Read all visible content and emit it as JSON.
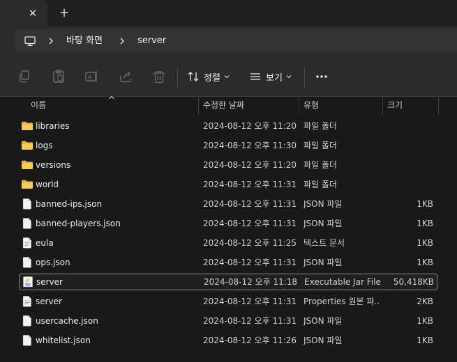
{
  "tabs": {
    "close_glyph": "✕",
    "new_glyph": "+"
  },
  "breadcrumb": {
    "items": [
      "바탕 화면",
      "server"
    ]
  },
  "toolbar": {
    "sort_label": "정렬",
    "view_label": "보기"
  },
  "columns": {
    "name": "이름",
    "date": "수정한 날짜",
    "type": "유형",
    "size": "크기"
  },
  "files": [
    {
      "name": "libraries",
      "date": "2024-08-12 오후 11:20",
      "type": "파일 폴더",
      "size": "",
      "icon": "folder-icon"
    },
    {
      "name": "logs",
      "date": "2024-08-12 오후 11:30",
      "type": "파일 폴더",
      "size": "",
      "icon": "folder-icon"
    },
    {
      "name": "versions",
      "date": "2024-08-12 오후 11:20",
      "type": "파일 폴더",
      "size": "",
      "icon": "folder-icon"
    },
    {
      "name": "world",
      "date": "2024-08-12 오후 11:31",
      "type": "파일 폴더",
      "size": "",
      "icon": "folder-icon"
    },
    {
      "name": "banned-ips.json",
      "date": "2024-08-12 오후 11:31",
      "type": "JSON 파일",
      "size": "1KB",
      "icon": "file-icon"
    },
    {
      "name": "banned-players.json",
      "date": "2024-08-12 오후 11:31",
      "type": "JSON 파일",
      "size": "1KB",
      "icon": "file-icon"
    },
    {
      "name": "eula",
      "date": "2024-08-12 오후 11:25",
      "type": "텍스트 문서",
      "size": "1KB",
      "icon": "text-file-icon"
    },
    {
      "name": "ops.json",
      "date": "2024-08-12 오후 11:31",
      "type": "JSON 파일",
      "size": "1KB",
      "icon": "file-icon"
    },
    {
      "name": "server",
      "date": "2024-08-12 오후 11:18",
      "type": "Executable Jar File",
      "size": "50,418KB",
      "icon": "jar-file-icon",
      "selected": true
    },
    {
      "name": "server",
      "date": "2024-08-12 오후 11:31",
      "type": "Properties 원본 파...",
      "size": "2KB",
      "icon": "text-file-icon"
    },
    {
      "name": "usercache.json",
      "date": "2024-08-12 오후 11:31",
      "type": "JSON 파일",
      "size": "1KB",
      "icon": "file-icon"
    },
    {
      "name": "whitelist.json",
      "date": "2024-08-12 오후 11:26",
      "type": "JSON 파일",
      "size": "1KB",
      "icon": "file-icon"
    }
  ]
}
